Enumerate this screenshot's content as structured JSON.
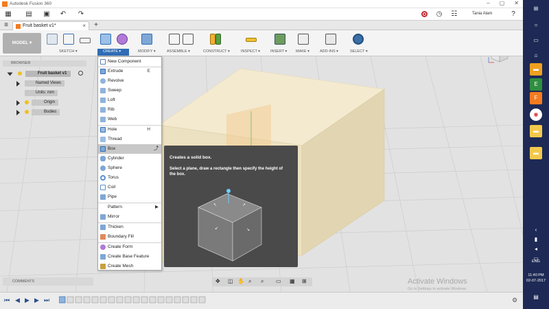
{
  "window": {
    "title": "Autodesk Fusion 360"
  },
  "appbar": {
    "user": "Tania Alam"
  },
  "tab": {
    "name": "Fruit basket v1*"
  },
  "toolbar": {
    "model": "MODEL ▾",
    "groups": [
      "SKETCH ▾",
      "CREATE ▾",
      "MODIFY ▾",
      "ASSEMBLE ▾",
      "CONSTRUCT ▾",
      "INSPECT ▾",
      "INSERT ▾",
      "MAKE ▾",
      "ADD-INS ▾",
      "SELECT ▾"
    ]
  },
  "browser": {
    "header": "BROWSER",
    "root": "Fruit basket v1",
    "items": [
      "Named Views",
      "Units: mm",
      "Origin",
      "Bodies"
    ]
  },
  "create_menu": {
    "items": [
      {
        "label": "New Component",
        "key": ""
      },
      {
        "label": "Extrude",
        "key": "E"
      },
      {
        "label": "Revolve",
        "key": ""
      },
      {
        "label": "Sweep",
        "key": ""
      },
      {
        "label": "Loft",
        "key": ""
      },
      {
        "label": "Rib",
        "key": ""
      },
      {
        "label": "Web",
        "key": ""
      },
      {
        "label": "Hole",
        "key": "H"
      },
      {
        "label": "Thread",
        "key": ""
      },
      {
        "label": "Box",
        "key": ""
      },
      {
        "label": "Cylinder",
        "key": ""
      },
      {
        "label": "Sphere",
        "key": ""
      },
      {
        "label": "Torus",
        "key": ""
      },
      {
        "label": "Coil",
        "key": ""
      },
      {
        "label": "Pipe",
        "key": ""
      },
      {
        "label": "Pattern",
        "key": "▶"
      },
      {
        "label": "Mirror",
        "key": ""
      },
      {
        "label": "Thicken",
        "key": ""
      },
      {
        "label": "Boundary Fill",
        "key": ""
      },
      {
        "label": "Create Form",
        "key": ""
      },
      {
        "label": "Create Base Feature",
        "key": ""
      },
      {
        "label": "Create Mesh",
        "key": ""
      }
    ]
  },
  "tooltip": {
    "title": "Creates a solid box.",
    "description": "Select a plane, draw a rectangle then specify the height of the box."
  },
  "comments": {
    "label": "COMMENTS"
  },
  "watermark": {
    "title": "Activate Windows",
    "subtitle": "Go to Settings to activate Windows."
  },
  "taskbar": {
    "lang": "ENG",
    "time": "11:40 PM",
    "date": "02-07-2017"
  },
  "colors": {
    "accent": "#2f6db5",
    "taskbar": "#1e2a55",
    "box": "#ece1c0",
    "tooltip": "#4a4a4a"
  }
}
